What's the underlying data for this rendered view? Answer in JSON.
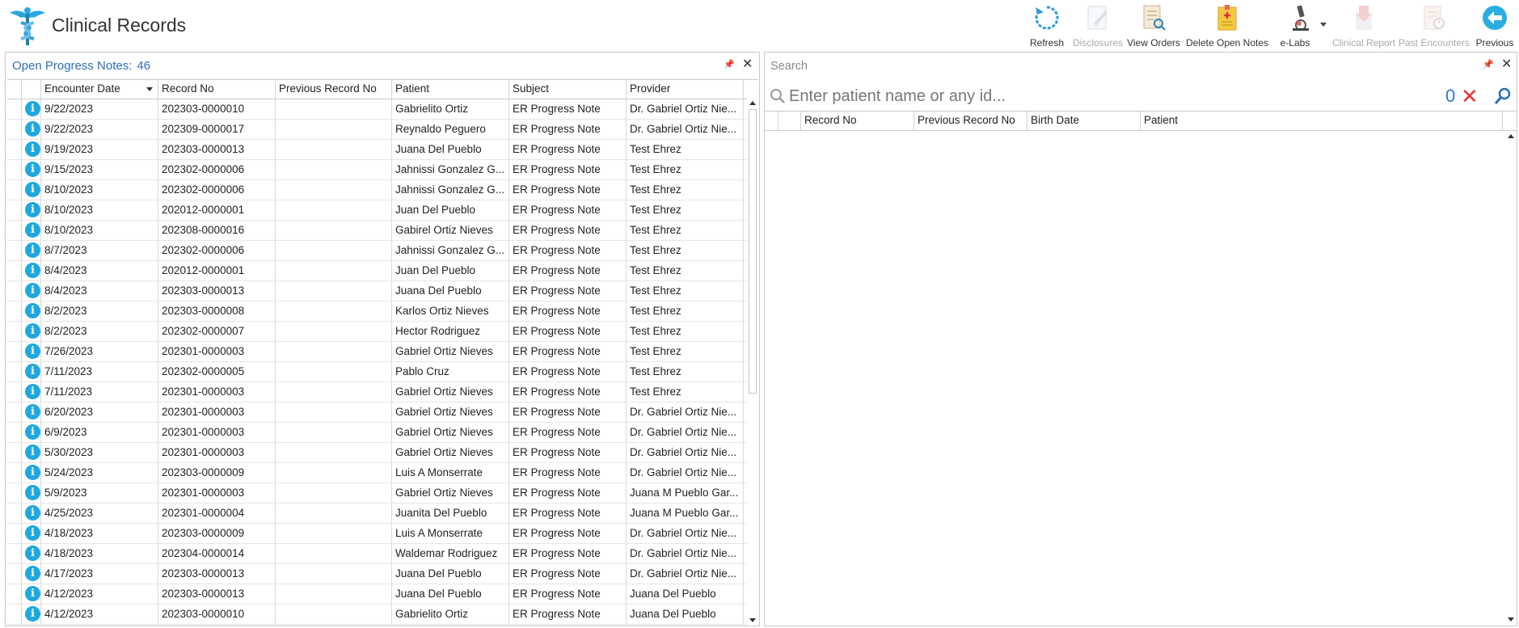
{
  "app": {
    "title": "Clinical Records"
  },
  "toolbar": {
    "buttons": [
      {
        "label": "Refresh",
        "icon": "refresh-icon",
        "enabled": true
      },
      {
        "label": "Disclosures",
        "icon": "edit-document-icon",
        "enabled": false
      },
      {
        "label": "View Orders",
        "icon": "view-document-icon",
        "enabled": true
      },
      {
        "label": "Delete Open Notes",
        "icon": "delete-notes-icon",
        "enabled": true
      },
      {
        "label": "e-Labs",
        "icon": "microscope-icon",
        "enabled": true
      },
      {
        "label": "Clinical Report",
        "icon": "clinical-report-icon",
        "enabled": false
      },
      {
        "label": "Past Encounters",
        "icon": "past-encounters-icon",
        "enabled": false
      },
      {
        "label": "Previous",
        "icon": "back-arrow-icon",
        "enabled": true
      }
    ]
  },
  "left_panel": {
    "title": "Open Progress Notes:",
    "count": "46",
    "columns": [
      "Encounter Date",
      "Record No",
      "Previous Record No",
      "Patient",
      "Subject",
      "Provider"
    ],
    "rows": [
      [
        "9/22/2023",
        "202303-0000010",
        "",
        "Gabrielito Ortiz",
        "ER Progress Note",
        "Dr. Gabriel Ortiz Nie..."
      ],
      [
        "9/22/2023",
        "202309-0000017",
        "",
        "Reynaldo Peguero",
        "ER Progress Note",
        "Dr. Gabriel Ortiz Nie..."
      ],
      [
        "9/19/2023",
        "202303-0000013",
        "",
        "Juana Del Pueblo",
        "ER Progress Note",
        "Test Ehrez"
      ],
      [
        "9/15/2023",
        "202302-0000006",
        "",
        "Jahnissi Gonzalez G...",
        "ER Progress Note",
        "Test Ehrez"
      ],
      [
        "8/10/2023",
        "202302-0000006",
        "",
        "Jahnissi Gonzalez G...",
        "ER Progress Note",
        "Test Ehrez"
      ],
      [
        "8/10/2023",
        "202012-0000001",
        "",
        "Juan Del Pueblo",
        "ER Progress Note",
        "Test Ehrez"
      ],
      [
        "8/10/2023",
        "202308-0000016",
        "",
        "Gabirel Ortiz Nieves",
        "ER Progress Note",
        "Test Ehrez"
      ],
      [
        "8/7/2023",
        "202302-0000006",
        "",
        "Jahnissi Gonzalez G...",
        "ER Progress Note",
        "Test Ehrez"
      ],
      [
        "8/4/2023",
        "202012-0000001",
        "",
        "Juan Del Pueblo",
        "ER Progress Note",
        "Test Ehrez"
      ],
      [
        "8/4/2023",
        "202303-0000013",
        "",
        "Juana Del Pueblo",
        "ER Progress Note",
        "Test Ehrez"
      ],
      [
        "8/2/2023",
        "202303-0000008",
        "",
        "Karlos Ortiz Nieves",
        "ER Progress Note",
        "Test Ehrez"
      ],
      [
        "8/2/2023",
        "202302-0000007",
        "",
        "Hector Rodriguez",
        "ER Progress Note",
        "Test Ehrez"
      ],
      [
        "7/26/2023",
        "202301-0000003",
        "",
        "Gabriel Ortiz Nieves",
        "ER Progress Note",
        "Test Ehrez"
      ],
      [
        "7/11/2023",
        "202302-0000005",
        "",
        "Pablo Cruz",
        "ER Progress Note",
        "Test Ehrez"
      ],
      [
        "7/11/2023",
        "202301-0000003",
        "",
        "Gabriel Ortiz Nieves",
        "ER Progress Note",
        "Test Ehrez"
      ],
      [
        "6/20/2023",
        "202301-0000003",
        "",
        "Gabriel Ortiz Nieves",
        "ER Progress Note",
        "Dr. Gabriel Ortiz Nie..."
      ],
      [
        "6/9/2023",
        "202301-0000003",
        "",
        "Gabriel Ortiz Nieves",
        "ER Progress Note",
        "Dr. Gabriel Ortiz Nie..."
      ],
      [
        "5/30/2023",
        "202301-0000003",
        "",
        "Gabriel Ortiz Nieves",
        "ER Progress Note",
        "Dr. Gabriel Ortiz Nie..."
      ],
      [
        "5/24/2023",
        "202303-0000009",
        "",
        "Luis A Monserrate",
        "ER Progress Note",
        "Dr. Gabriel Ortiz Nie..."
      ],
      [
        "5/9/2023",
        "202301-0000003",
        "",
        "Gabriel Ortiz Nieves",
        "ER Progress Note",
        "Juana M Pueblo Gar..."
      ],
      [
        "4/25/2023",
        "202301-0000004",
        "",
        "Juanita Del Pueblo",
        "ER Progress Note",
        "Juana M Pueblo Gar..."
      ],
      [
        "4/18/2023",
        "202303-0000009",
        "",
        "Luis A Monserrate",
        "ER Progress Note",
        "Dr. Gabriel Ortiz Nie..."
      ],
      [
        "4/18/2023",
        "202304-0000014",
        "",
        "Waldemar Rodriguez",
        "ER Progress Note",
        "Dr. Gabriel Ortiz Nie..."
      ],
      [
        "4/17/2023",
        "202303-0000013",
        "",
        "Juana Del Pueblo",
        "ER Progress Note",
        "Dr. Gabriel Ortiz Nie..."
      ],
      [
        "4/12/2023",
        "202303-0000013",
        "",
        "Juana Del Pueblo",
        "ER Progress Note",
        "Juana Del Pueblo"
      ],
      [
        "4/12/2023",
        "202303-0000010",
        "",
        "Gabrielito Ortiz",
        "ER Progress Note",
        "Juana Del Pueblo"
      ]
    ],
    "row_icon": "info-icon"
  },
  "right_panel": {
    "title": "Search",
    "search": {
      "placeholder": "Enter patient name or any id...",
      "value": ""
    },
    "result_count": "0",
    "columns": [
      "Record No",
      "Previous Record No",
      "Birth Date",
      "Patient"
    ]
  },
  "colors": {
    "accent": "#2d6fb3",
    "info": "#1fa7e0",
    "clear": "#e63535"
  }
}
